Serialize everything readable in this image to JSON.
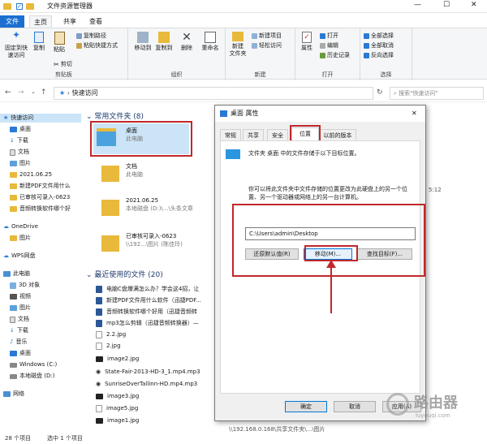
{
  "window": {
    "title": "文件资源管理器"
  },
  "tabs": [
    {
      "label": "文件"
    },
    {
      "label": "主页"
    },
    {
      "label": "共享"
    },
    {
      "label": "查看"
    }
  ],
  "ribbon": {
    "clipboard": {
      "label": "剪贴板",
      "pin": "固定到快\n速访问",
      "copy": "复制",
      "paste": "粘贴",
      "copy_path": "复制路径",
      "paste_shortcut": "粘贴快捷方式",
      "cut": "剪切"
    },
    "organize": {
      "label": "组织",
      "move_to": "移动到",
      "copy_to": "复制到",
      "delete": "删除",
      "rename": "重命名"
    },
    "new": {
      "label": "新建",
      "new_folder": "新建\n文件夹",
      "new_item": "新建项目",
      "easy_access": "轻松访问"
    },
    "open": {
      "label": "打开",
      "properties": "属性",
      "open": "打开",
      "edit": "编辑",
      "history": "历史记录"
    },
    "select": {
      "label": "选择",
      "select_all": "全部选择",
      "select_none": "全部取消",
      "invert": "反向选择"
    }
  },
  "address": {
    "path": "快速访问",
    "search_placeholder": "搜索\"快速访问\""
  },
  "nav": {
    "items": [
      "快速访问",
      "桌面",
      "下载",
      "文档",
      "图片",
      "2021.06.25",
      "新建PDF文件用什么",
      "已审核可录入-0623",
      "音频转换软件哪个好",
      "OneDrive",
      "图片",
      "WPS网盘",
      "此电脑",
      "3D 对象",
      "视频",
      "图片",
      "文档",
      "下载",
      "音乐",
      "桌面",
      "Windows (C:)",
      "本地磁盘 (D:)",
      "网络"
    ]
  },
  "frequent": {
    "header": "常用文件夹 (8)",
    "tiles": [
      {
        "name": "桌面",
        "sub": "此电脑"
      },
      {
        "name": "文档",
        "sub": "此电脑"
      },
      {
        "name": "2021.06.25",
        "sub": "本地磁盘 (D:)\\...\\头条文章"
      },
      {
        "name": "已审核可录入-0623",
        "sub": "\\\\192...\\图片 (陈佳玲)"
      }
    ]
  },
  "recent": {
    "header": "最近使用的文件 (20)",
    "items": [
      "电脑C盘爆满怎么办？学会这4招，让",
      "新建PDF文件用什么软件（迅捷PDF...",
      "音频转换软件哪个好用（迅捷音频转",
      "mp3怎么剪辑（迅捷音频转换器）—",
      "2.2.jpg",
      "2.jpg",
      "image2.jpg",
      "State-Fair-2013-HD-3_1.mp4.mp3",
      "SunriseOverTallinn-HD.mp4.mp3",
      "image3.jpg",
      "image5.jpg",
      "image1.jpg"
    ],
    "path_fragment": "\\\\192.168.0.168\\共享文件夹\\...\\图片",
    "time_fragment": "5:12"
  },
  "status": {
    "count": "28 个项目",
    "selected": "选中 1 个项目"
  },
  "dialog": {
    "title": "桌面 属性",
    "close": "✕",
    "tabs": [
      "常规",
      "共享",
      "安全",
      "位置",
      "以前的版本"
    ],
    "folder_desc": "文件夹 桌面 中的文件存储于以下目标位置。",
    "info": "你可以将此文件夹中文件存储的位置更改为此硬盘上的另一个位置、另一个驱动器或网络上的另一台计算机。",
    "path_value": "C:\\Users\\admin\\Desktop",
    "restore": "还原默认值(R)",
    "move": "移动(M)...",
    "find": "查找目标(F)...",
    "ok": "确定",
    "cancel": "取消",
    "apply": "应用(A)"
  },
  "watermark": {
    "text": "路由器",
    "sub": "luyouqi.com"
  }
}
